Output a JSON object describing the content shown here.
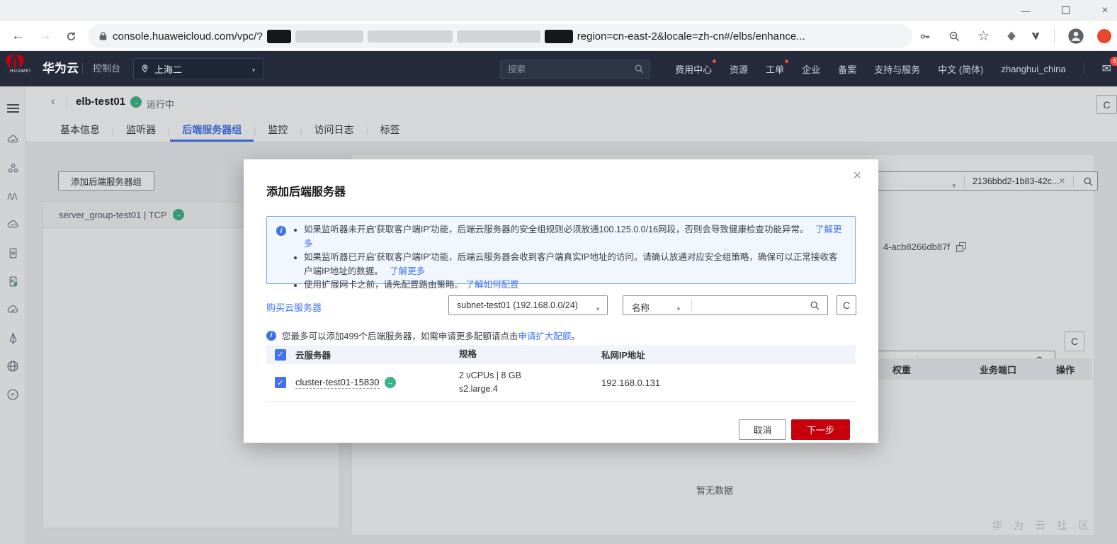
{
  "colors": {
    "brand_red": "#c7000b",
    "link_blue": "#3d73f5",
    "accent_blue": "#4372ec",
    "status_green": "#3cb586",
    "topnav_bg": "#252b3a",
    "notice_bg": "#f2f7ff",
    "notice_border": "#7da7ea"
  },
  "browser": {
    "url_prefix": "console.huaweicloud.com/vpc/?",
    "url_suffix": "region=cn-east-2&locale=zh-cn#/elbs/enhance..."
  },
  "topnav": {
    "logo_text": "HUAWEI",
    "brand": "华为云",
    "console": "控制台",
    "region": "上海二",
    "search_placeholder": "搜索",
    "items": [
      {
        "label": "费用中心"
      },
      {
        "label": "资源"
      },
      {
        "label": "工单"
      },
      {
        "label": "企业"
      },
      {
        "label": "备案"
      },
      {
        "label": "支持与服务"
      },
      {
        "label": "中文 (简体)"
      },
      {
        "label": "zhanghui_china"
      }
    ],
    "mail_badge": "6"
  },
  "page": {
    "title": "elb-test01",
    "status": "运行中",
    "tabs": [
      "基本信息",
      "监听器",
      "后端服务器组",
      "监控",
      "访问日志",
      "标签"
    ]
  },
  "background": {
    "add_group_button": "添加后端服务器组",
    "group_item": "server_group-test01 | TCP",
    "id_search_value": "2136bbd2-1b83-42c...",
    "resource_id_fragment": "4-acb8266db87f",
    "member_table_headers": [
      "权重",
      "业务端口",
      "操作"
    ],
    "empty_text": "暂无数据",
    "watermark": "华 为 云 社 区"
  },
  "modal": {
    "title": "添加后端服务器",
    "notices": [
      {
        "text": "如果监听器未开启'获取客户端IP'功能，后端云服务器的安全组规则必须放通100.125.0.0/16网段，否则会导致健康检查功能异常。",
        "link": "了解更多"
      },
      {
        "text": "如果监听器已开启'获取客户端IP'功能，后端云服务器会收到客户端真实IP地址的访问。请确认放通对应安全组策略，确保可以正常接收客户端IP地址的数据。",
        "link": "了解更多"
      },
      {
        "text": "使用扩展网卡之前，请先配置路由策略。",
        "link": "了解如何配置"
      }
    ],
    "buy_link": "购买云服务器",
    "subnet_select": "subnet-test01 (192.168.0.0/24)",
    "filter_select": "名称",
    "quota_text_before": "您最多可以添加499个后端服务器，如需申请更多配额请点击",
    "quota_link": "申请扩大配额",
    "quota_text_after": "。",
    "table": {
      "headers": [
        "云服务器",
        "规格",
        "私网IP地址"
      ],
      "row": {
        "name": "cluster-test01-15830",
        "spec_line1": "2 vCPUs | 8 GB",
        "spec_line2": "s2.large.4",
        "ip": "192.168.0.131"
      }
    },
    "cancel_label": "取消",
    "next_label": "下一步"
  }
}
